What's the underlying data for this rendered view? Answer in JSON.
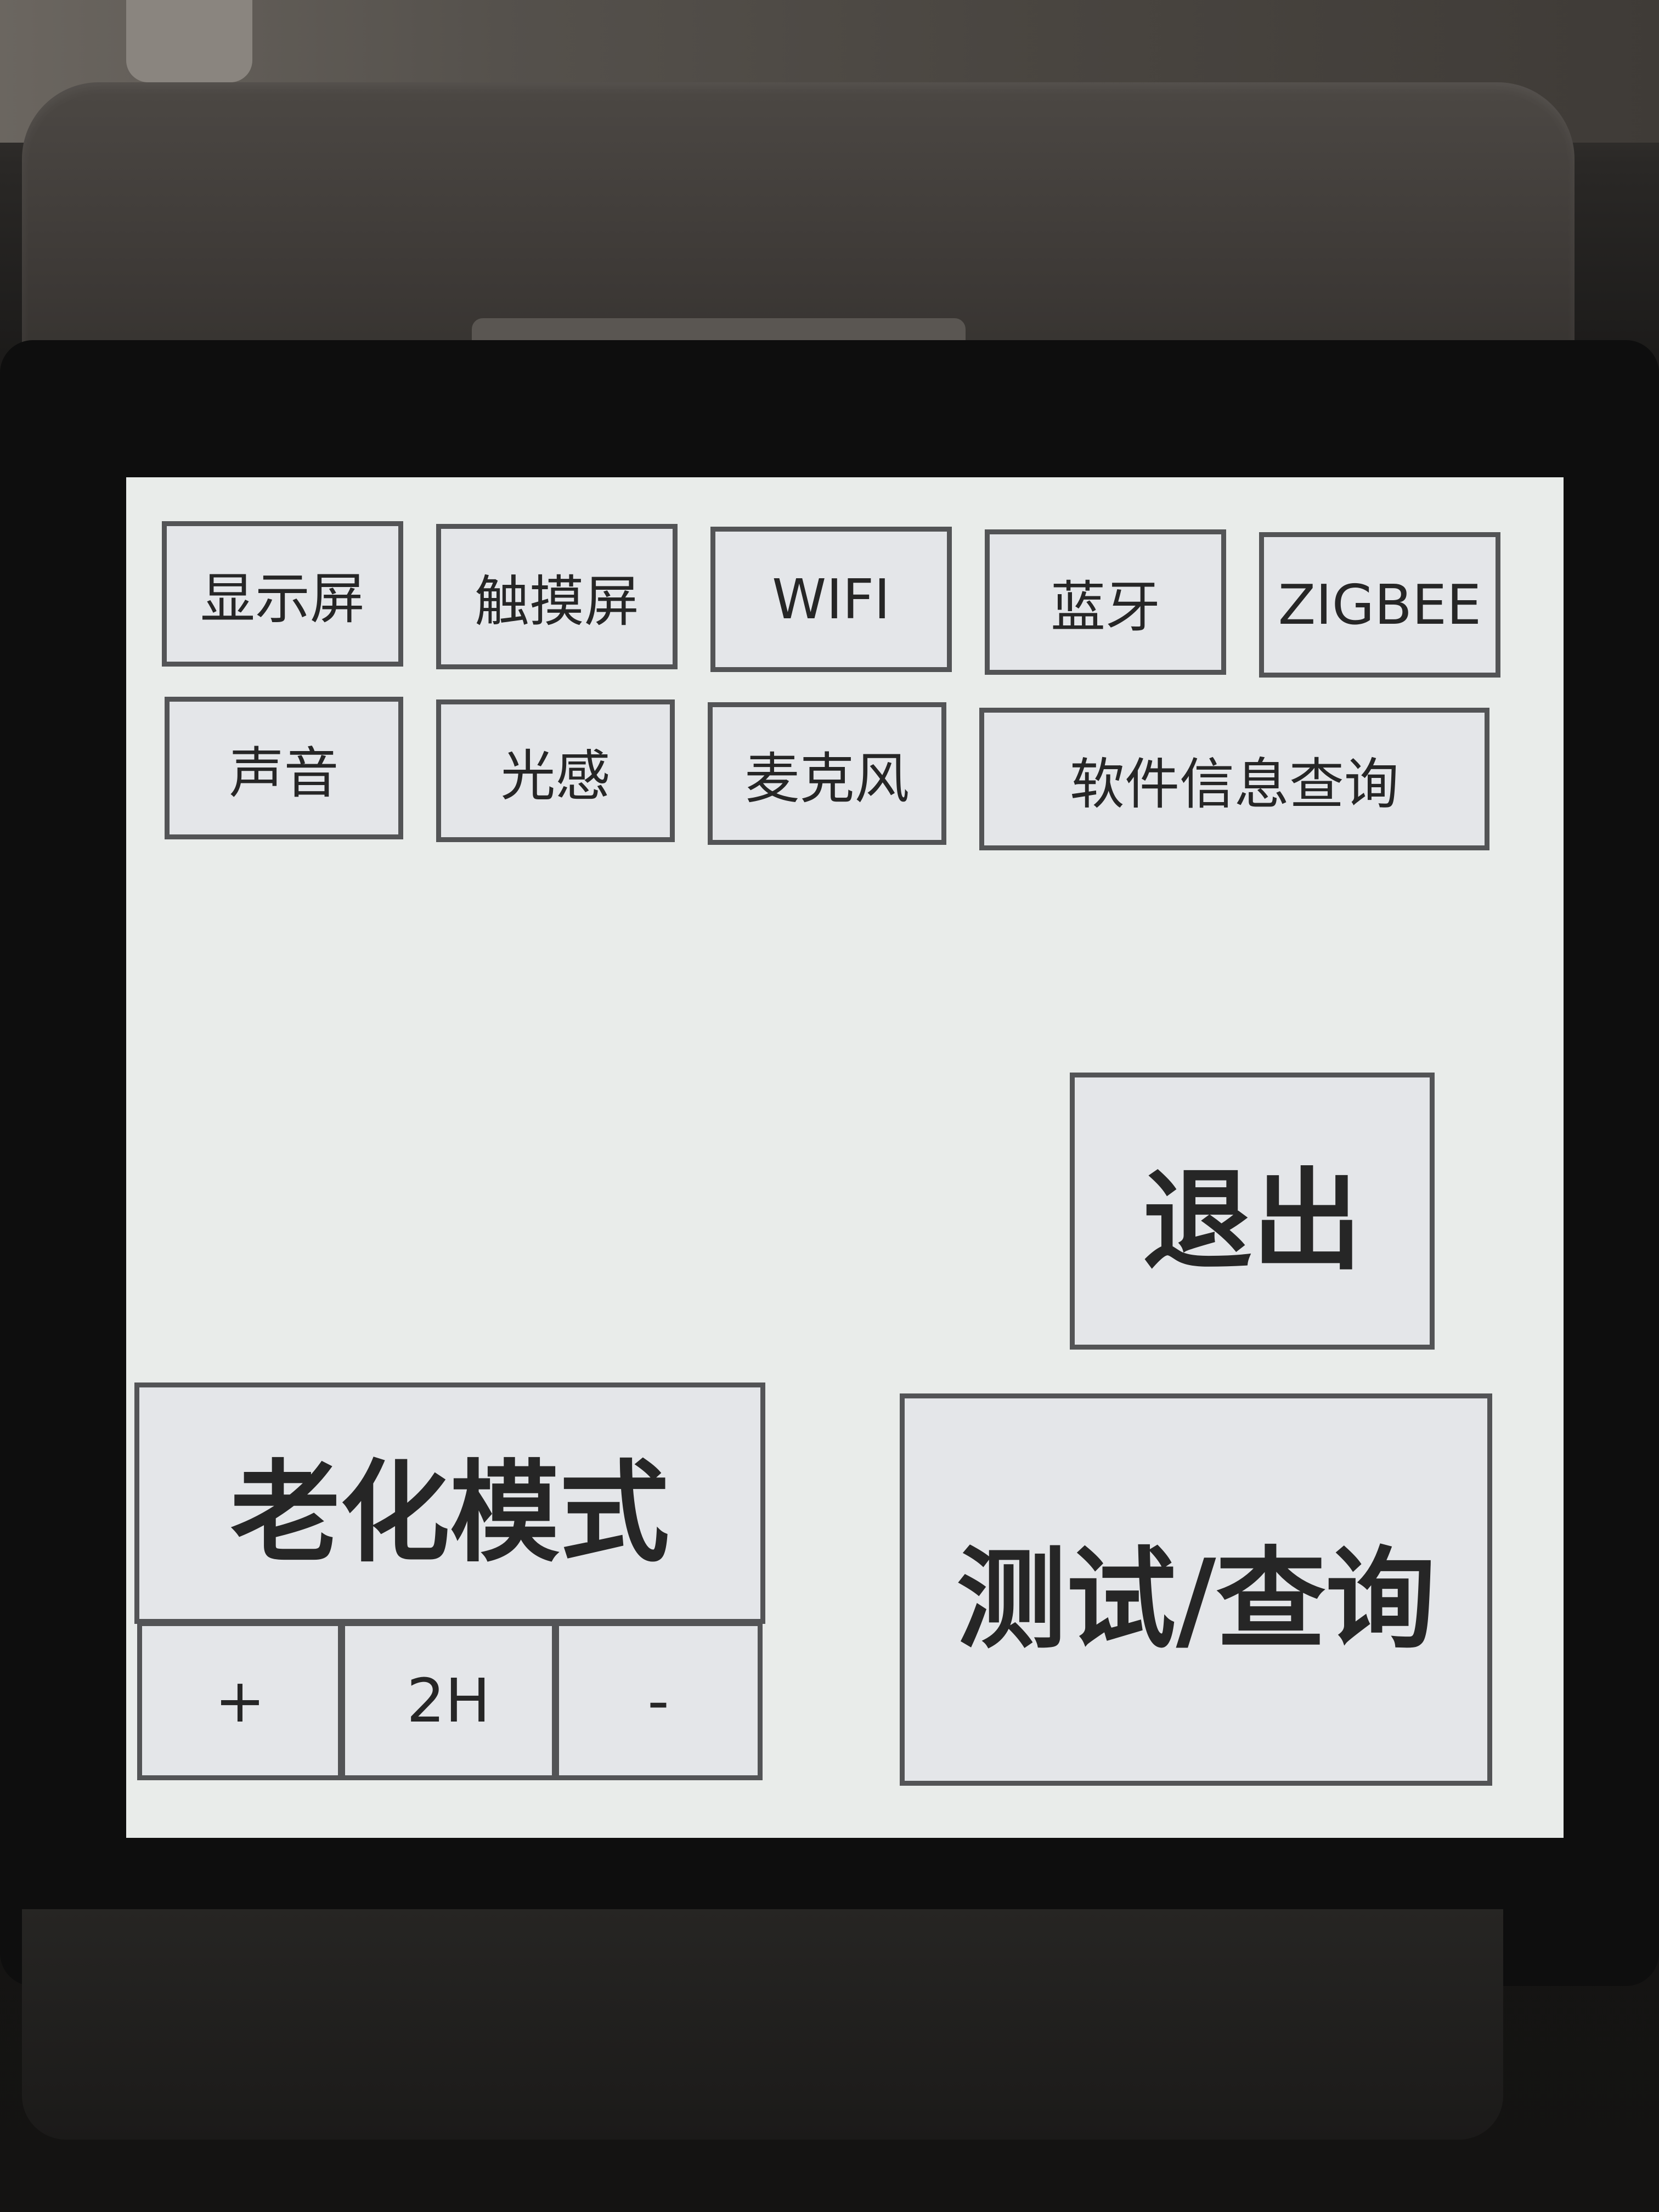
{
  "test_menu": {
    "row1": [
      "显示屏",
      "触摸屏",
      "WIFI",
      "蓝牙",
      "ZIGBEE"
    ],
    "row2": [
      "声音",
      "光感",
      "麦克风",
      "软件信息查询"
    ]
  },
  "exit_label": "退出",
  "aging": {
    "title": "老化模式",
    "increase_label": "+",
    "duration_value": "2H",
    "decrease_label": "-"
  },
  "test_query_label": "测试/查询"
}
